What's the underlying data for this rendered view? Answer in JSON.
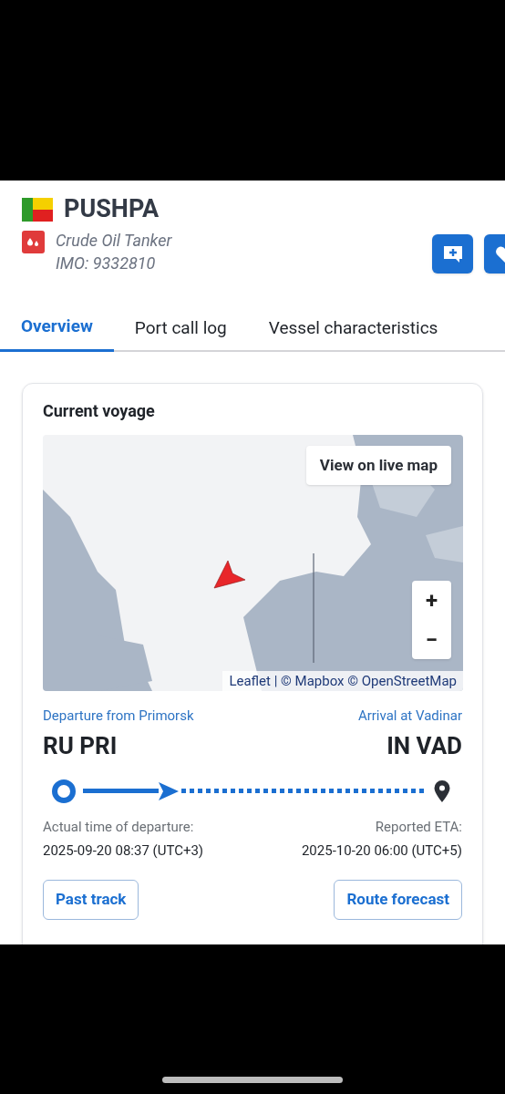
{
  "vessel": {
    "name": "PUSHPA",
    "type": "Crude Oil Tanker",
    "imo": "IMO: 9332810"
  },
  "tabs": [
    {
      "label": "Overview",
      "selected": true
    },
    {
      "label": "Port call log",
      "selected": false
    },
    {
      "label": "Vessel characteristics",
      "selected": false
    }
  ],
  "voyage": {
    "title": "Current voyage",
    "map": {
      "kind": "picture",
      "live_map_button": "View on live map",
      "zoom_in": "+",
      "zoom_out": "−",
      "attribution": "Leaflet | © Mapbox © OpenStreetMap"
    },
    "departure": {
      "label": "Departure from Primorsk",
      "code": "RU PRI",
      "time_label": "Actual time of departure:",
      "time": "2025-09-20 08:37 (UTC+3)"
    },
    "arrival": {
      "label": "Arrival at Vadinar",
      "code": "IN VAD",
      "time_label": "Reported ETA:",
      "time": "2025-10-20 06:00 (UTC+5)"
    },
    "buttons": [
      "Past track",
      "Route forecast"
    ]
  }
}
